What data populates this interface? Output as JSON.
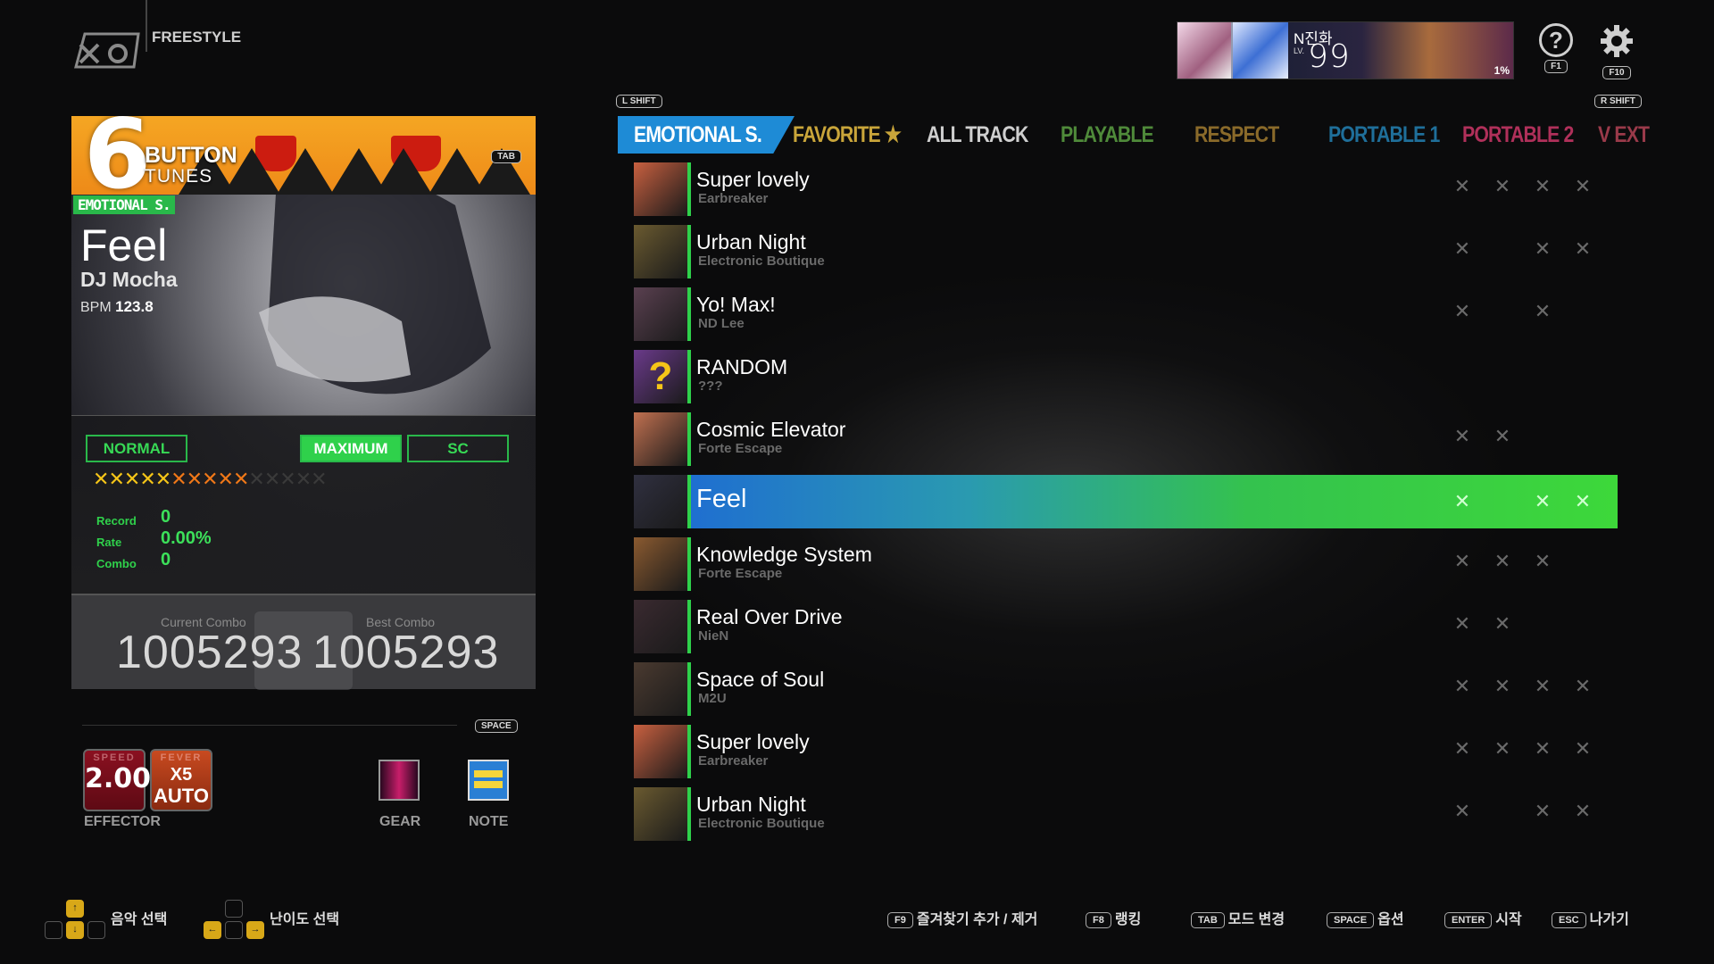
{
  "header": {
    "mode_title": "FREESTYLE"
  },
  "player_card": {
    "name": "N진화",
    "level_prefix": "LV.",
    "level": "99",
    "percent": "1%"
  },
  "top_right": {
    "help_key": "F1",
    "settings_key": "F10"
  },
  "mode_banner": {
    "number": "6",
    "button_word": "BUTTON",
    "tunes_word": "TUNES",
    "tab_key": "TAB"
  },
  "song_info": {
    "category": "EMOTIONAL S.",
    "title": "Feel",
    "artist": "DJ Mocha",
    "bpm_label": "BPM",
    "bpm": "123.8"
  },
  "difficulty": {
    "buttons": [
      "NORMAL",
      "MAXIMUM",
      "SC"
    ],
    "selected": "MAXIMUM",
    "stars_filled_yellow": 5,
    "stars_filled_orange": 5,
    "stars_empty": 5
  },
  "stats": {
    "record_label": "Record",
    "record": "0",
    "rate_label": "Rate",
    "rate": "0.00%",
    "combo_label": "Combo",
    "combo": "0"
  },
  "combo_box": {
    "current_label": "Current Combo",
    "current": "1005293",
    "best_label": "Best Combo",
    "best": "1005293"
  },
  "options": {
    "space_key": "SPACE",
    "speed_caption": "SPEED",
    "speed": "2.00",
    "fever_caption": "FEVER",
    "fever_mult": "X5",
    "fever_mode": "AUTO",
    "effector_label": "EFFECTOR",
    "gear_label": "GEAR",
    "note_label": "NOTE"
  },
  "tabs": {
    "left_shift": "L SHIFT",
    "right_shift": "R SHIFT",
    "items": [
      {
        "label": "EMOTIONAL S.",
        "color": "#ffffff"
      },
      {
        "label": "FAVORITE ★",
        "color": "#c9a53a"
      },
      {
        "label": "ALL TRACK",
        "color": "#cfcfcf"
      },
      {
        "label": "PLAYABLE",
        "color": "#4f8a3a"
      },
      {
        "label": "RESPECT",
        "color": "#8a6a2a"
      },
      {
        "label": "PORTABLE 1",
        "color": "#1f6f9a"
      },
      {
        "label": "PORTABLE 2",
        "color": "#b0305a"
      },
      {
        "label": "V EXT",
        "color": "#9a3a4a"
      }
    ]
  },
  "songs": [
    {
      "title": "Super lovely",
      "artist": "Earbreaker",
      "marks": [
        1,
        1,
        1,
        1
      ],
      "thumb": "#c86040"
    },
    {
      "title": "Urban Night",
      "artist": "Electronic Boutique",
      "marks": [
        1,
        0,
        1,
        1
      ],
      "thumb": "#6a5a30"
    },
    {
      "title": "Yo! Max!",
      "artist": "ND Lee",
      "marks": [
        1,
        0,
        1,
        0
      ],
      "thumb": "#5a4050"
    },
    {
      "title": "RANDOM",
      "artist": "???",
      "marks": [
        0,
        0,
        0,
        0
      ],
      "thumb": "#6a3a8a"
    },
    {
      "title": "Cosmic Elevator",
      "artist": "Forte Escape",
      "marks": [
        1,
        1,
        0,
        0
      ],
      "thumb": "#c07050"
    },
    {
      "title": "Feel",
      "artist": "",
      "marks": [
        1,
        0,
        1,
        1
      ],
      "thumb": "#303040",
      "selected": true
    },
    {
      "title": "Knowledge System",
      "artist": "Forte Escape",
      "marks": [
        1,
        1,
        1,
        0
      ],
      "thumb": "#8a5a30"
    },
    {
      "title": "Real Over Drive",
      "artist": "NieN",
      "marks": [
        1,
        1,
        0,
        0
      ],
      "thumb": "#3a2a30"
    },
    {
      "title": "Space of Soul",
      "artist": "M2U",
      "marks": [
        1,
        1,
        1,
        1
      ],
      "thumb": "#4a3a30"
    },
    {
      "title": "Super lovely",
      "artist": "Earbreaker",
      "marks": [
        1,
        1,
        1,
        1
      ],
      "thumb": "#c86040"
    },
    {
      "title": "Urban Night",
      "artist": "Electronic Boutique",
      "marks": [
        1,
        0,
        1,
        1
      ],
      "thumb": "#6a5a30"
    }
  ],
  "hints": {
    "music_select": "음악 선택",
    "difficulty_select": "난이도 선택",
    "f9_key": "F9",
    "f9_label": "즐겨찾기 추가 / 제거",
    "f8_key": "F8",
    "f8_label": "랭킹",
    "tab_key": "TAB",
    "tab_label": "모드 변경",
    "space_key": "SPACE",
    "space_label": "옵션",
    "enter_key": "ENTER",
    "enter_label": "시작",
    "esc_key": "ESC",
    "esc_label": "나가기"
  }
}
